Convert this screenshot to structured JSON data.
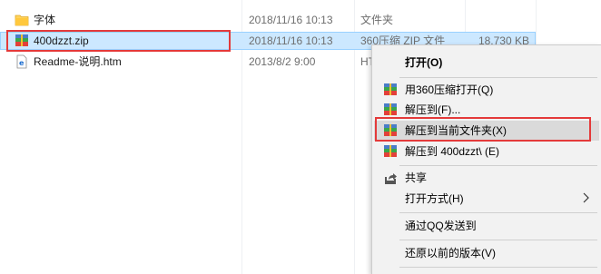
{
  "files": [
    {
      "name": "字体",
      "date": "2018/11/16 10:13",
      "type": "文件夹",
      "size": "",
      "icon": "folder-icon"
    },
    {
      "name": "400dzzt.zip",
      "date": "2018/11/16 10:13",
      "type": "360压缩 ZIP 文件",
      "size": "18,730 KB",
      "icon": "zip-archive-icon"
    },
    {
      "name": "Readme-说明.htm",
      "date": "2013/8/2 9:00",
      "type": "HT",
      "size": "",
      "icon": "html-document-icon"
    }
  ],
  "menu": {
    "open": "打开(O)",
    "open_with_360": "用360压缩打开(Q)",
    "extract_to": "解压到(F)...",
    "extract_here_folder": "解压到当前文件夹(X)",
    "extract_to_named": "解压到 400dzzt\\ (E)",
    "share": "共享",
    "open_with": "打开方式(H)",
    "send_qq": "通过QQ发送到",
    "restore_prev": "还原以前的版本(V)"
  },
  "colors": {
    "highlight_box": "#e43a3a",
    "selection": "#cce8ff"
  }
}
